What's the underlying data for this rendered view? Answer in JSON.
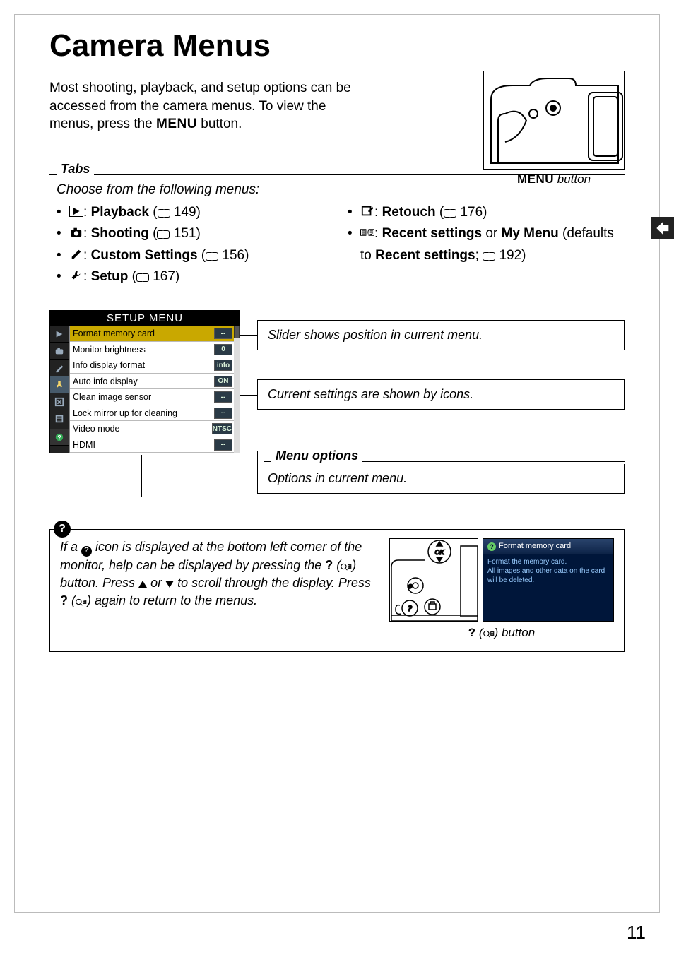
{
  "title": "Camera Menus",
  "intro_before": "Most shooting, playback, and setup options can be accessed from the camera menus.  To view the menus, press the ",
  "intro_menu_word": "MENU",
  "intro_after": " button.",
  "camera_caption_menu": "MENU",
  "camera_caption_suffix": " button",
  "tabs_label": "Tabs",
  "tabs_choose": "Choose from the following menus:",
  "menus_left": [
    {
      "icon": "play",
      "bold": "Playback",
      "page": "149"
    },
    {
      "icon": "camera",
      "bold": "Shooting",
      "page": "151"
    },
    {
      "icon": "pencil",
      "bold": "Custom Settings",
      "page": "156"
    },
    {
      "icon": "wrench",
      "bold": "Setup",
      "page": "167"
    }
  ],
  "menus_right": [
    {
      "icon": "retouch",
      "bold": "Retouch",
      "page": "176"
    },
    {
      "icon": "recent",
      "bold": "Recent settings",
      "mid": " or ",
      "bold2": "My Menu",
      "after": " (defaults to ",
      "bold3": "Recent settings",
      "after2": "; ",
      "page": "192",
      "after3": ")"
    }
  ],
  "setup_menu": {
    "title": "SETUP MENU",
    "rows": [
      {
        "label": "Format memory card",
        "val": "--",
        "sel": true
      },
      {
        "label": "Monitor brightness",
        "val": "0"
      },
      {
        "label": "Info display format",
        "val": "info"
      },
      {
        "label": "Auto info display",
        "val": "ON"
      },
      {
        "label": "Clean image sensor",
        "val": "--"
      },
      {
        "label": "Lock mirror up for cleaning",
        "val": "--"
      },
      {
        "label": "Video mode",
        "val": "NTSC"
      },
      {
        "label": "HDMI",
        "val": "--"
      }
    ]
  },
  "callouts": {
    "slider": "Slider shows position in current menu.",
    "icons": "Current settings are shown by icons.",
    "options_label": "Menu options",
    "options_text": "Options in current menu."
  },
  "help": {
    "t1": "If a ",
    "t2": " icon is displayed at the bottom left corner of the monitor, help can be displayed by pressing the ",
    "q1": "?",
    "t3": " (",
    "t4": ") button.  Press ",
    "t5": " or ",
    "t6": " to scroll through the display.  Press ",
    "q2": "?",
    "t7": " (",
    "t8": ") again to return to the menus.",
    "screen_title": "Format memory card",
    "screen_body1": "Format the memory card.",
    "screen_body2": "All images and other data on the card will be deleted.",
    "caption_q": "?",
    "caption_mid": " (",
    "caption_after": ") button"
  },
  "page_number": "11"
}
